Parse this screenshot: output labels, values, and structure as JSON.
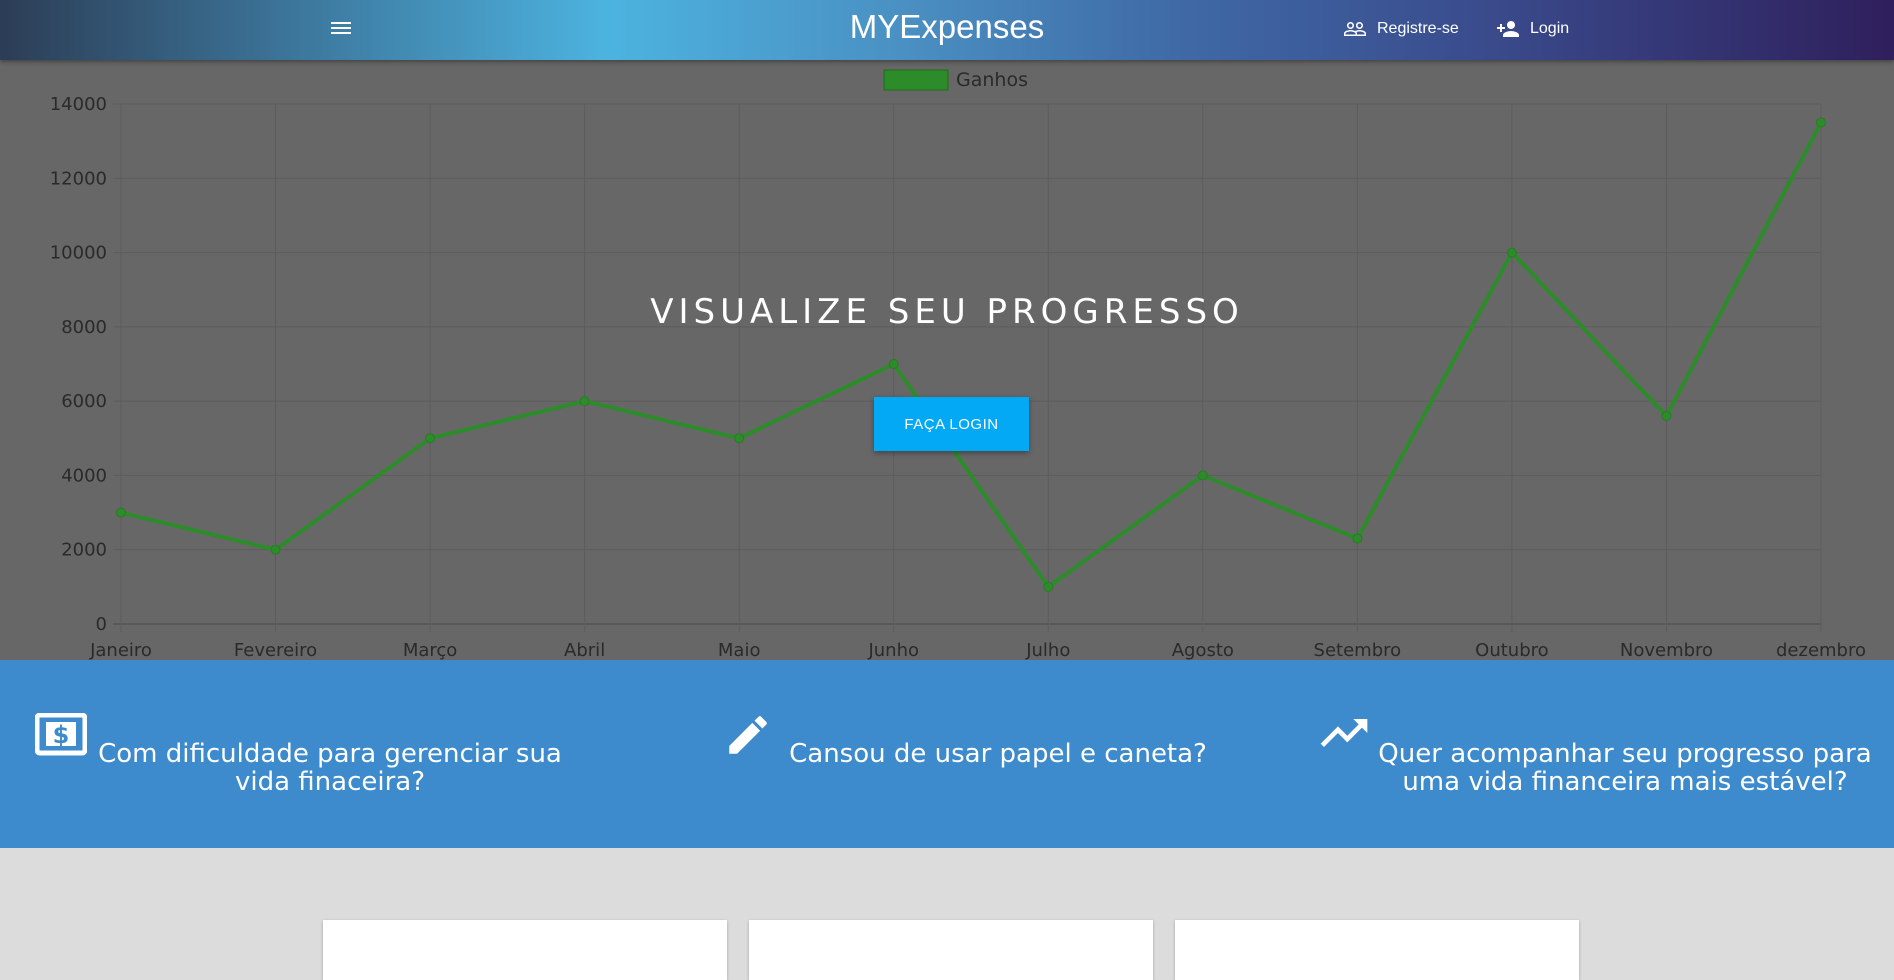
{
  "navbar": {
    "menu_icon": "menu-icon",
    "brand": "MYExpenses",
    "register": {
      "label": "Registre-se",
      "icon": "people-icon"
    },
    "login": {
      "label": "Login",
      "icon": "person-add-icon"
    }
  },
  "hero": {
    "title": "VISUALIZE SEU PROGRESSO",
    "button_label": "FAÇA LOGIN"
  },
  "chart_data": {
    "type": "line",
    "categories": [
      "Janeiro",
      "Fevereiro",
      "Março",
      "Abril",
      "Maio",
      "Junho",
      "Julho",
      "Agosto",
      "Setembro",
      "Outubro",
      "Novembro",
      "dezembro"
    ],
    "series": [
      {
        "name": "Ganhos",
        "values": [
          3000,
          2000,
          5000,
          6000,
          5000,
          7000,
          1000,
          4000,
          2300,
          10000,
          5600,
          13500
        ],
        "color": "#2d8c2a"
      }
    ],
    "yticks": [
      0,
      2000,
      4000,
      6000,
      8000,
      10000,
      12000,
      14000
    ],
    "ylim": [
      0,
      14000
    ],
    "grid": true,
    "legend": "top-center"
  },
  "features": [
    {
      "icon": "money-icon",
      "text": "Com dificuldade para gerenciar sua vida finaceira?"
    },
    {
      "icon": "pencil-icon",
      "text": "Cansou de usar papel e caneta?"
    },
    {
      "icon": "trending-up-icon",
      "text": "Quer acompanhar seu progresso para uma vida financeira mais estável?"
    }
  ],
  "colors": {
    "feature_bg": "#3d8bcd",
    "button": "#03a9f4",
    "line": "#2d8c2a"
  }
}
